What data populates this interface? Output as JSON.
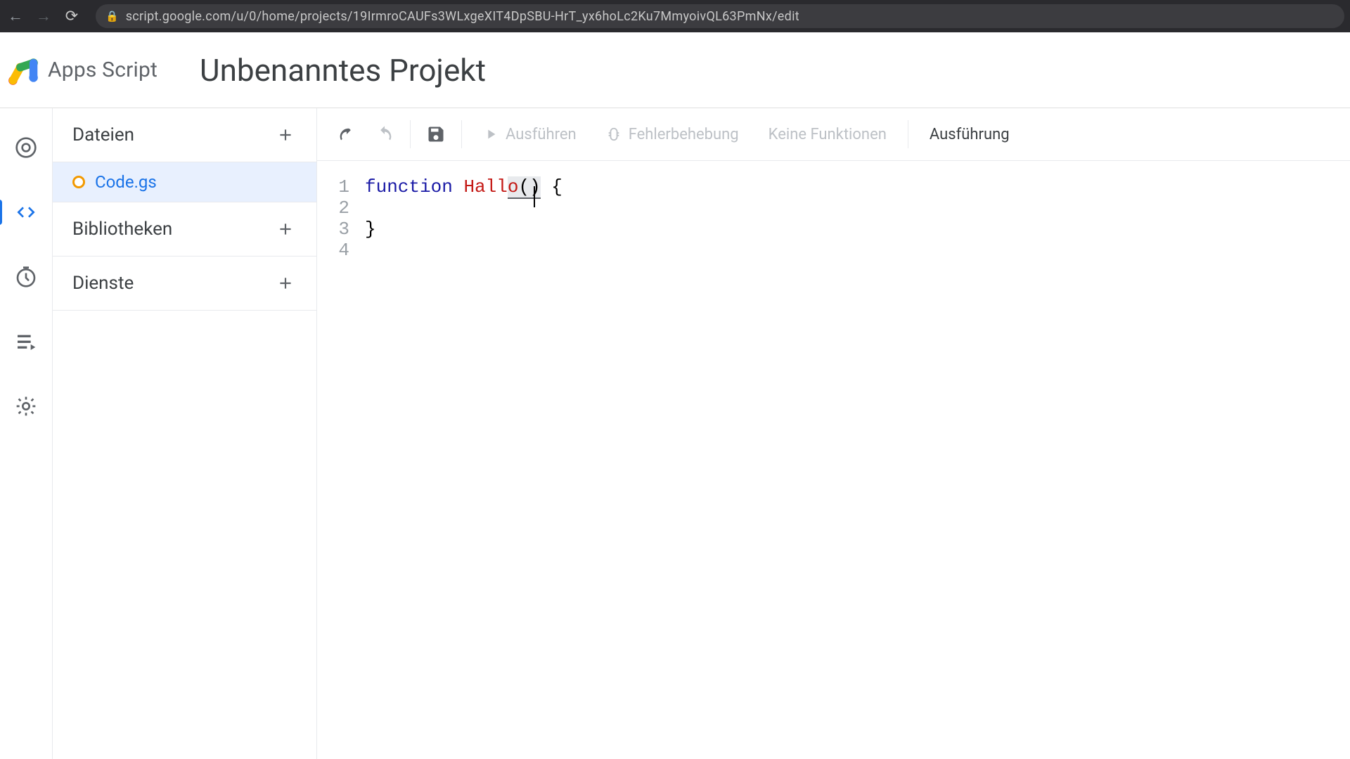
{
  "browser": {
    "url": "script.google.com/u/0/home/projects/19IrmroCAUFs3WLxgeXIT4DpSBU-HrT_yx6hoLc2Ku7MmyoivQL63PmNx/edit"
  },
  "header": {
    "logo_text": "Apps Script",
    "project_title": "Unbenanntes Projekt"
  },
  "sidebar": {
    "sections": {
      "files": "Dateien",
      "libraries": "Bibliotheken",
      "services": "Dienste"
    },
    "active_file": "Code.gs"
  },
  "toolbar": {
    "run": "Ausführen",
    "debug": "Fehlerbehebung",
    "func_selector": "Keine Funktionen",
    "exec_log": "Ausführung"
  },
  "code": {
    "line_numbers": [
      "1",
      "2",
      "3",
      "4"
    ],
    "tokens": {
      "keyword": "function",
      "fn_name_a": "Hall",
      "fn_name_b": "o",
      "parens": "()",
      "brace_open": " {",
      "brace_close": "}"
    }
  }
}
